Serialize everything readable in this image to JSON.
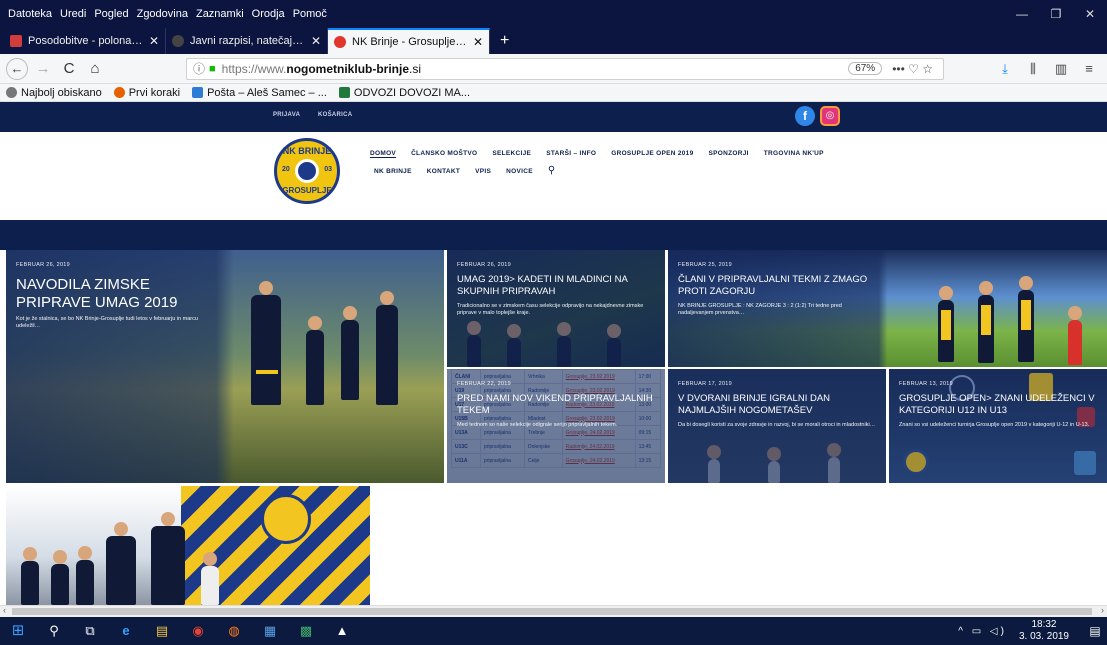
{
  "menubar": {
    "items": [
      "Datoteka",
      "Uredi",
      "Pogled",
      "Zgodovina",
      "Zaznamki",
      "Orodja",
      "Pomoč"
    ],
    "window_controls": [
      "—",
      "❐",
      "✕"
    ]
  },
  "tabs": [
    {
      "title": "Posodobitve - polona.samec@",
      "icon_color": "#d23c3c",
      "active": false
    },
    {
      "title": "Javni razpisi, natečaji... Občine",
      "icon_color": "#444444",
      "active": false
    },
    {
      "title": "NK Brinje - Grosuplje - Uradna",
      "icon_color": "#e2352b",
      "active": true
    }
  ],
  "newtab_label": "+",
  "navbar": {
    "url_protocol": "https://www.",
    "url_host": "nogometniklub-brinje",
    "url_tld": ".si",
    "zoom": "67%",
    "page_actions": "•••  ♡  ☆"
  },
  "bookmarks": [
    {
      "label": "Najbolj obiskano",
      "icon": "gear-icon",
      "color": "#777777"
    },
    {
      "label": "Prvi koraki",
      "icon": "firefox-icon",
      "color": "#e66000"
    },
    {
      "label": "Pošta – Aleš Samec – ...",
      "icon": "mail-icon",
      "color": "#2d7cd6"
    },
    {
      "label": "ODVOZI DOVOZI MA...",
      "icon": "excel-icon",
      "color": "#1f7a3e"
    }
  ],
  "site": {
    "top_links": [
      "PRIJAVA",
      "KOŠARICA"
    ],
    "logo": {
      "top": "NK BRINJE",
      "left": "20",
      "right": "03",
      "bottom": "GROSUPLJE"
    },
    "nav_row1": [
      "DOMOV",
      "ČLANSKO MOŠTVO",
      "SELEKCIJE",
      "STARŠI – INFO",
      "GROSUPLJE OPEN 2019",
      "SPONZORJI",
      "TRGOVINA NK'UP"
    ],
    "nav_row2": [
      "NK BRINJE",
      "KONTAKT",
      "VPIS",
      "NOVICE"
    ],
    "social": {
      "facebook": "f",
      "instagram": "◎"
    },
    "colors": {
      "navy": "#0d1f4d",
      "yellow": "#f2c521"
    }
  },
  "posts": [
    {
      "date": "FEBRUAR 26, 2019",
      "title": "NAVODILA ZIMSKE PRIPRAVE UMAG 2019",
      "excerpt": "Kot je že stalnica, se bo NK Brinje-Grosuplje tudi letos v februarju in marcu udeležil…"
    },
    {
      "date": "FEBRUAR 26, 2019",
      "title": "UMAG 2019> KADETI IN MLADINCI NA SKUPNIH PRIPRAVAH",
      "excerpt": "Tradicionalno se v zimskem času selekcije odpravijo na nekajdnevne zimske priprave v malo toplejše kraje."
    },
    {
      "date": "FEBRUAR 25, 2019",
      "title": "ČLANI V PRIPRAVLJALNI TEKMI Z ZMAGO PROTI ZAGORJU",
      "excerpt": "NK BRINJE GROSUPLJE : NK ZAGORJE 3 : 2 (1:2) Tri tedne pred nadaljevanjem prvenstva…"
    },
    {
      "date": "FEBRUAR 22, 2019",
      "title": "PRED NAMI NOV VIKEND PRIPRAVLJALNIH TEKEM",
      "excerpt": "Med tednom so naše selekcije odigrale serijo pripravljalnih tekem."
    },
    {
      "date": "FEBRUAR 17, 2019",
      "title": "V DVORANI BRINJE IGRALNI DAN NAJMLAJŠIH NOGOMETAŠEV",
      "excerpt": "Da bi dosegli koristi za svoje zdravje in razvoj, bi se morali otroci in mladostniki…"
    },
    {
      "date": "FEBRUAR 13, 2019",
      "title": "GROSUPLJE OPEN> ZNANI UDELEŽENCI V KATEGORIJI U12 IN U13",
      "excerpt": "Znani so vsi udeleženci turnirja Grosuplje open 2019 v kategoriji U-12 in U-13."
    }
  ],
  "schedule_rows": [
    [
      "ČLANI",
      "pripravljalna",
      "Vrhnika",
      "Grosuplje, 23.02.2019",
      "17:00"
    ],
    [
      "U19",
      "pripravljalna",
      "Radomlje",
      "Grosuplje, 23.02.2019",
      "14:30"
    ],
    [
      "U17",
      "pripravljalna",
      "Radomlje",
      "Radomlje, 23.02.2019",
      "13:00"
    ],
    [
      "U15B",
      "pripravljalna",
      "Mladost",
      "Grosuplje, 23.02.2019",
      "10:00"
    ],
    [
      "U13A",
      "pripravljalna",
      "Trebnje",
      "Grosuplje, 24.02.2019",
      "09:15"
    ],
    [
      "U13C",
      "pripravljalna",
      "Dolenjske",
      "Radomlje, 24.02.2019",
      "13:45"
    ],
    [
      "U11A",
      "pripravljalna",
      "Celje",
      "Grosuplje, 24.02.2019",
      "13:15"
    ]
  ],
  "taskbar": {
    "apps": [
      "⊞",
      "⚲",
      "⧉",
      "e",
      "▤",
      "◉",
      "◍",
      "▦",
      "▩",
      "▲"
    ],
    "tray_icons": "^ ▭ ◁)",
    "time": "18:32",
    "date": "3. 03. 2019",
    "notification": "▤"
  }
}
